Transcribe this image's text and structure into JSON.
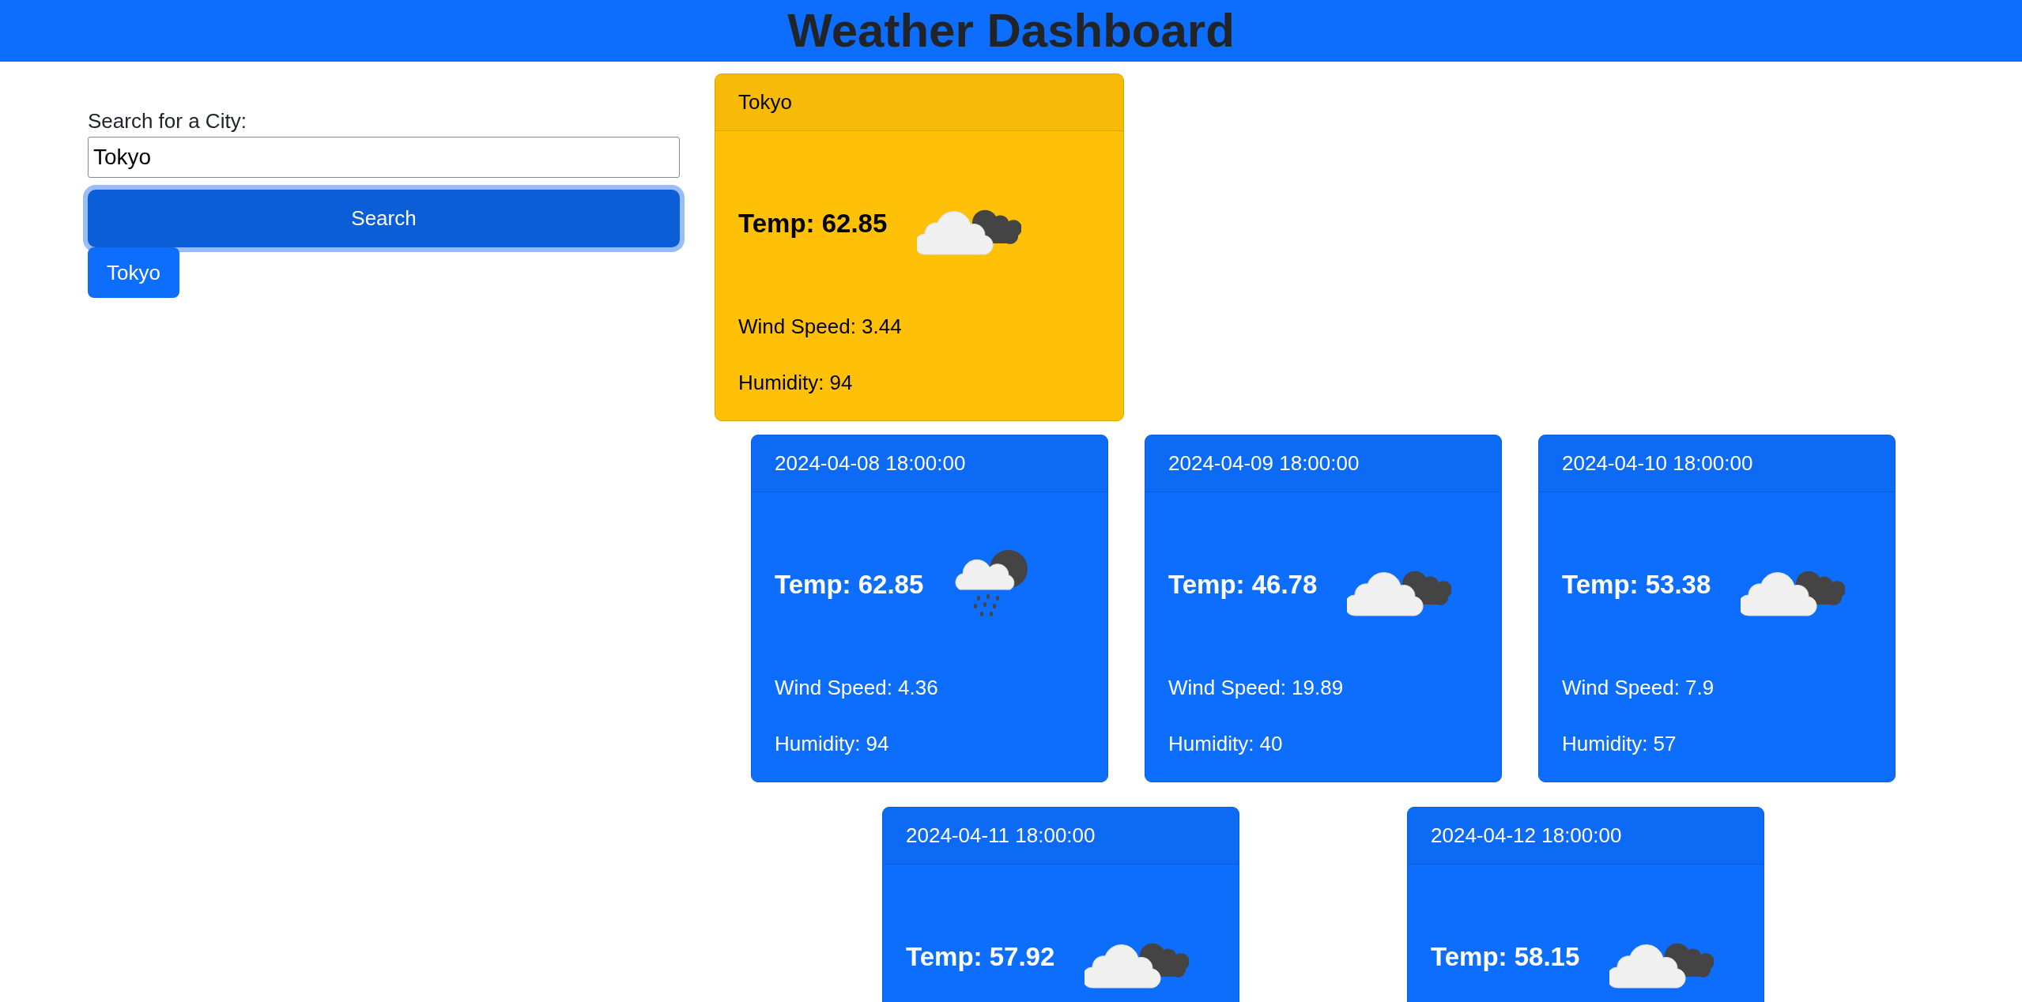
{
  "header": {
    "title": "Weather Dashboard"
  },
  "search": {
    "label": "Search for a City:",
    "value": "Tokyo",
    "button": {
      "label": "Search",
      "focused": true
    }
  },
  "history": [
    {
      "label": "Tokyo"
    }
  ],
  "current": {
    "title": "Tokyo",
    "temp": "Temp: 62.85",
    "kind": "clouds",
    "wind": "Wind Speed: 3.44",
    "humidity": "Humidity: 94"
  },
  "forecast": [
    {
      "title": "2024-04-08 18:00:00",
      "temp": "Temp: 62.85",
      "kind": "rain",
      "wind": "Wind Speed: 4.36",
      "humidity": "Humidity: 94"
    },
    {
      "title": "2024-04-09 18:00:00",
      "temp": "Temp: 46.78",
      "kind": "clouds",
      "wind": "Wind Speed: 19.89",
      "humidity": "Humidity: 40"
    },
    {
      "title": "2024-04-10 18:00:00",
      "temp": "Temp: 53.38",
      "kind": "clouds",
      "wind": "Wind Speed: 7.9",
      "humidity": "Humidity: 57"
    },
    {
      "title": "2024-04-11 18:00:00",
      "temp": "Temp: 57.92",
      "kind": "clouds"
    },
    {
      "title": "2024-04-12 18:00:00",
      "temp": "Temp: 58.15",
      "kind": "clouds"
    }
  ]
}
